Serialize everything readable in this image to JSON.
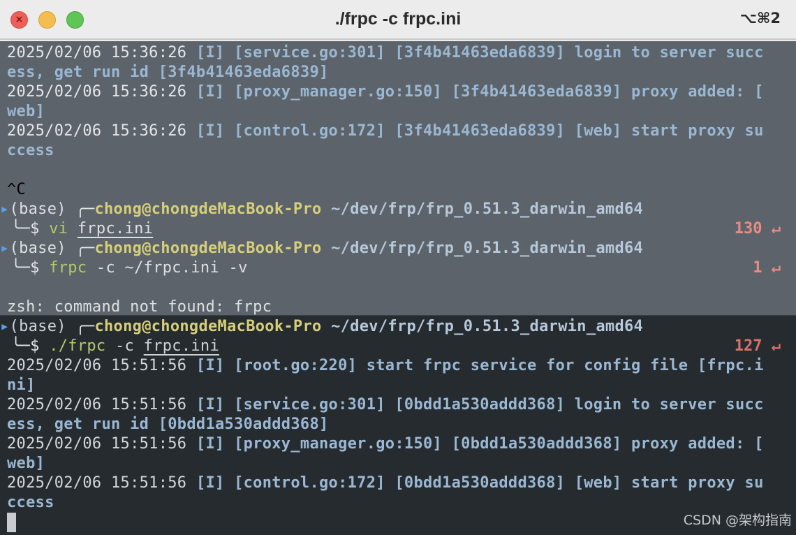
{
  "window": {
    "title": "./frpc -c frpc.ini",
    "shortcut": "⌥⌘2",
    "buttons": {
      "close_glyph": "×"
    }
  },
  "top_pane": {
    "log1": {
      "ts": "2025/02/06 15:36:26",
      "body": " [I] [service.go:301] [3f4b41463eda6839] login to server succ",
      "cont": "ess, get run id [3f4b41463eda6839]"
    },
    "log2": {
      "ts": "2025/02/06 15:36:26",
      "body": " [I] [proxy_manager.go:150] [3f4b41463eda6839] proxy added: [",
      "cont": "web]"
    },
    "log3": {
      "ts": "2025/02/06 15:36:26",
      "body": " [I] [control.go:172] [3f4b41463eda6839] [web] start proxy su",
      "cont": "ccess"
    },
    "interrupt": "^C",
    "prompt1": {
      "env": "(base) ",
      "box_top": "╭─",
      "user": "chong@chongdeMacBook-Pro",
      "path": " ~/dev/frp/frp_0.51.3_darwin_amd64",
      "box_bottom": "╰─$ ",
      "cmd": "vi",
      "arg": "frpc.ini",
      "code": "130 ↵"
    },
    "prompt2": {
      "env": "(base) ",
      "box_top": "╭─",
      "user": "chong@chongdeMacBook-Pro",
      "path": " ~/dev/frp/frp_0.51.3_darwin_amd64",
      "box_bottom": "╰─$ ",
      "cmd": "frpc",
      "args": " -c ~/frpc.ini -v",
      "code": "1 ↵"
    },
    "error": "zsh: command not found: frpc"
  },
  "bottom_pane": {
    "prompt": {
      "env": "(base) ",
      "box_top": "╭─",
      "user": "chong@chongdeMacBook-Pro",
      "path": " ~/dev/frp/frp_0.51.3_darwin_amd64",
      "box_bottom": "╰─$ ",
      "cmd": "./frpc",
      "flag": " -c ",
      "arg": "frpc.ini",
      "code": "127 ↵"
    },
    "log1": {
      "ts": "2025/02/06 15:51:56",
      "body": " [I] [root.go:220] start frpc service for config file [frpc.i",
      "cont": "ni]"
    },
    "log2": {
      "ts": "2025/02/06 15:51:56",
      "body": " [I] [service.go:301] [0bdd1a530addd368] login to server succ",
      "cont": "ess, get run id [0bdd1a530addd368]"
    },
    "log3": {
      "ts": "2025/02/06 15:51:56",
      "body": " [I] [proxy_manager.go:150] [0bdd1a530addd368] proxy added: [",
      "cont": "web]"
    },
    "log4": {
      "ts": "2025/02/06 15:51:56",
      "body": " [I] [control.go:172] [0bdd1a530addd368] [web] start proxy su",
      "cont": "ccess"
    }
  },
  "watermark": "CSDN @架构指南",
  "colors": {
    "top_bg": "#5d636a",
    "bottom_bg": "#262b30",
    "user": "#d6cf7a",
    "return_code": "#e88b83",
    "cmd": "#b3c96a"
  }
}
